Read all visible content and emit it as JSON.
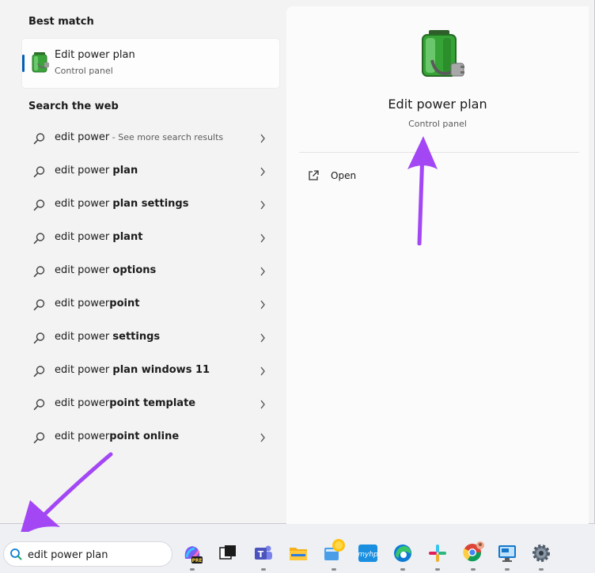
{
  "left": {
    "best_match_heading": "Best match",
    "best_match": {
      "title": "Edit power plan",
      "subtitle": "Control panel"
    },
    "web_heading": "Search the web",
    "web_results": [
      {
        "prefix": "edit power",
        "bold": "",
        "suffix": " - See more search results"
      },
      {
        "prefix": "edit power ",
        "bold": "plan",
        "suffix": ""
      },
      {
        "prefix": "edit power ",
        "bold": "plan settings",
        "suffix": ""
      },
      {
        "prefix": "edit power ",
        "bold": "plant",
        "suffix": ""
      },
      {
        "prefix": "edit power ",
        "bold": "options",
        "suffix": ""
      },
      {
        "prefix": "edit power",
        "bold": "point",
        "suffix": ""
      },
      {
        "prefix": "edit power ",
        "bold": "settings",
        "suffix": ""
      },
      {
        "prefix": "edit power ",
        "bold": "plan windows 11",
        "suffix": ""
      },
      {
        "prefix": "edit power",
        "bold": "point template",
        "suffix": ""
      },
      {
        "prefix": "edit power",
        "bold": "point online",
        "suffix": ""
      }
    ]
  },
  "preview": {
    "title": "Edit power plan",
    "subtitle": "Control panel",
    "open_label": "Open"
  },
  "taskbar": {
    "search_value": "edit power plan",
    "apps": [
      "copilot-icon",
      "task-view-icon",
      "teams-icon",
      "file-explorer-icon",
      "whatsapp-icon",
      "myhp-icon",
      "edge-icon",
      "slack-icon",
      "chrome-icon",
      "remote-desktop-icon",
      "settings-icon"
    ],
    "copilot_badge": "PRE",
    "myhp_label": "myhp"
  },
  "colors": {
    "accent": "#005fb8",
    "annotation_arrow": "#a347f5",
    "panel": "#f3f3f3",
    "preview_panel": "#fbfbfb"
  }
}
